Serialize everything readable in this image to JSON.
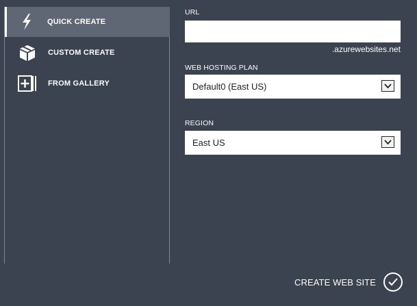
{
  "sidebar": {
    "items": [
      {
        "label": "QUICK CREATE",
        "icon": "lightning-icon",
        "active": true
      },
      {
        "label": "CUSTOM CREATE",
        "icon": "box-icon",
        "active": false
      },
      {
        "label": "FROM GALLERY",
        "icon": "gallery-add-icon",
        "active": false
      }
    ]
  },
  "form": {
    "url": {
      "label": "URL",
      "value": "",
      "placeholder": "",
      "suffix": ".azurewebsites.net"
    },
    "hosting_plan": {
      "label": "WEB HOSTING PLAN",
      "selected": "Default0 (East US)"
    },
    "region": {
      "label": "REGION",
      "selected": "East US"
    }
  },
  "footer": {
    "create_label": "CREATE WEB SITE",
    "icon": "checkmark-icon"
  },
  "colors": {
    "background": "#3b4350",
    "active_item": "#5f6774",
    "divider": "#7f8896",
    "input_bg": "#ffffff"
  }
}
